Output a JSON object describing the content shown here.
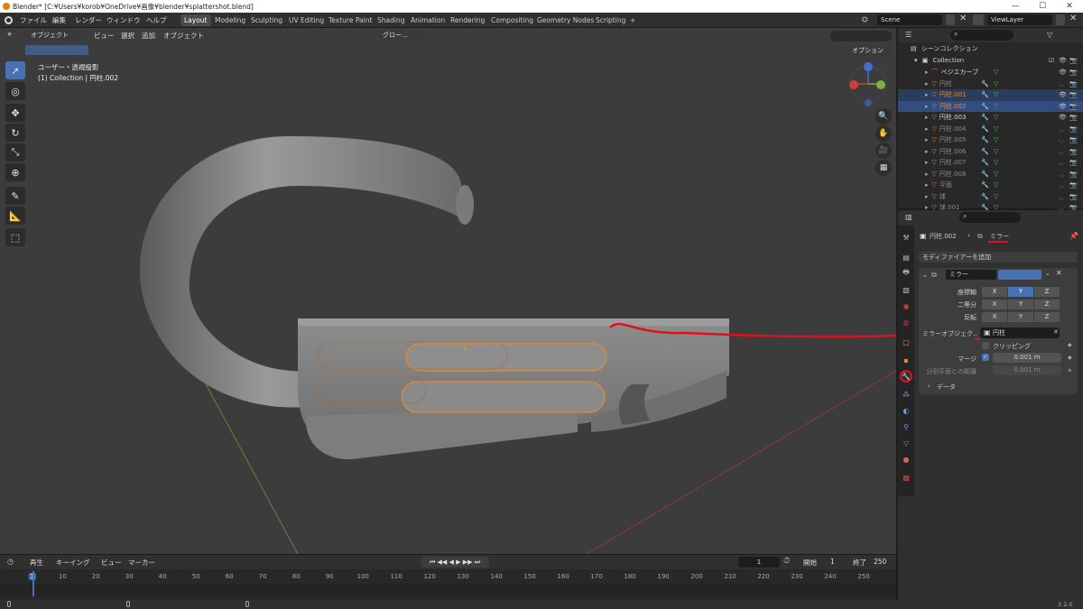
{
  "titlebar": {
    "title": "Blender* [C:¥Users¥korob¥OneDrive¥画像¥blender¥splattershot.blend]",
    "minimize": "—",
    "maximize": "☐",
    "close": "✕"
  },
  "menubar": {
    "menus": [
      "ファイル",
      "編集",
      "レンダー",
      "ウィンドウ",
      "ヘルプ"
    ],
    "workspaces": [
      "Layout",
      "Modeling",
      "Sculpting",
      "UV Editing",
      "Texture Paint",
      "Shading",
      "Animation",
      "Rendering",
      "Compositing",
      "Geometry Nodes",
      "Scripting"
    ],
    "active_workspace": "Layout",
    "add_workspace": "+",
    "scene": "Scene",
    "view_layer": "ViewLayer"
  },
  "viewport": {
    "mode": "オブジェクト",
    "menus": [
      "ビュー",
      "選択",
      "追加",
      "オブジェクト"
    ],
    "orientation": "グロー...",
    "options": "オプション",
    "view_name": "ユーザー・透視投影",
    "collection_info": "(1) Collection | 円柱.002",
    "tools": [
      "select-icon",
      "cursor-icon",
      "move-icon",
      "rotate-icon",
      "scale-icon",
      "transform-icon",
      "annotate-icon",
      "measure-icon",
      "add-cube-icon"
    ]
  },
  "outliner": {
    "header": "シーンコレクション",
    "collection": "Collection",
    "items": [
      {
        "name": "ベジエカーブ",
        "icon": "curve",
        "state": "normal"
      },
      {
        "name": "円柱",
        "icon": "mesh",
        "state": "dim"
      },
      {
        "name": "円柱.001",
        "icon": "mesh",
        "state": "selected"
      },
      {
        "name": "円柱.002",
        "icon": "mesh",
        "state": "active"
      },
      {
        "name": "円柱.003",
        "icon": "mesh",
        "state": "normal"
      },
      {
        "name": "円柱.004",
        "icon": "mesh",
        "state": "dim"
      },
      {
        "name": "円柱.005",
        "icon": "mesh",
        "state": "dim"
      },
      {
        "name": "円柱.006",
        "icon": "mesh",
        "state": "dim"
      },
      {
        "name": "円柱.007",
        "icon": "mesh",
        "state": "dim"
      },
      {
        "name": "円柱.008",
        "icon": "mesh",
        "state": "dim"
      },
      {
        "name": "平面",
        "icon": "mesh",
        "state": "dim"
      },
      {
        "name": "球",
        "icon": "mesh",
        "state": "dim"
      },
      {
        "name": "球.001",
        "icon": "mesh",
        "state": "dim"
      }
    ]
  },
  "properties": {
    "breadcrumb_object": "円柱.002",
    "breadcrumb_sep": "›",
    "breadcrumb_modifier": "ミラー",
    "add_modifier": "モディファイアーを追加",
    "modifier_name": "ミラー",
    "axis_label": "座標軸",
    "bisect_label": "二等分",
    "flip_label": "反転",
    "axes": [
      "X",
      "Y",
      "Z"
    ],
    "mirror_object_label": "ミラーオブジェク..",
    "mirror_object_value": "円柱",
    "clipping_label": "クリッピング",
    "merge_label": "マージ",
    "merge_value": "0.001 m",
    "bisect_distance_label": "分割平面との距離",
    "bisect_distance_value": "0.001 m",
    "data_label": "データ"
  },
  "timeline": {
    "menus": [
      "再生",
      "キーイング",
      "ビュー",
      "マーカー"
    ],
    "current_frame": "1",
    "start_label": "開始",
    "start_value": "1",
    "end_label": "終了",
    "end_value": "250",
    "ticks": [
      "1",
      "10",
      "20",
      "30",
      "40",
      "50",
      "60",
      "70",
      "80",
      "90",
      "100",
      "110",
      "120",
      "130",
      "140",
      "150",
      "160",
      "170",
      "180",
      "190",
      "200",
      "210",
      "220",
      "230",
      "240",
      "250"
    ]
  },
  "statusbar": {
    "version": "3.2.0"
  },
  "colors": {
    "accent": "#4772b3",
    "selection": "#334d80",
    "annotation": "#e0101c",
    "outline": "#e8892a"
  }
}
